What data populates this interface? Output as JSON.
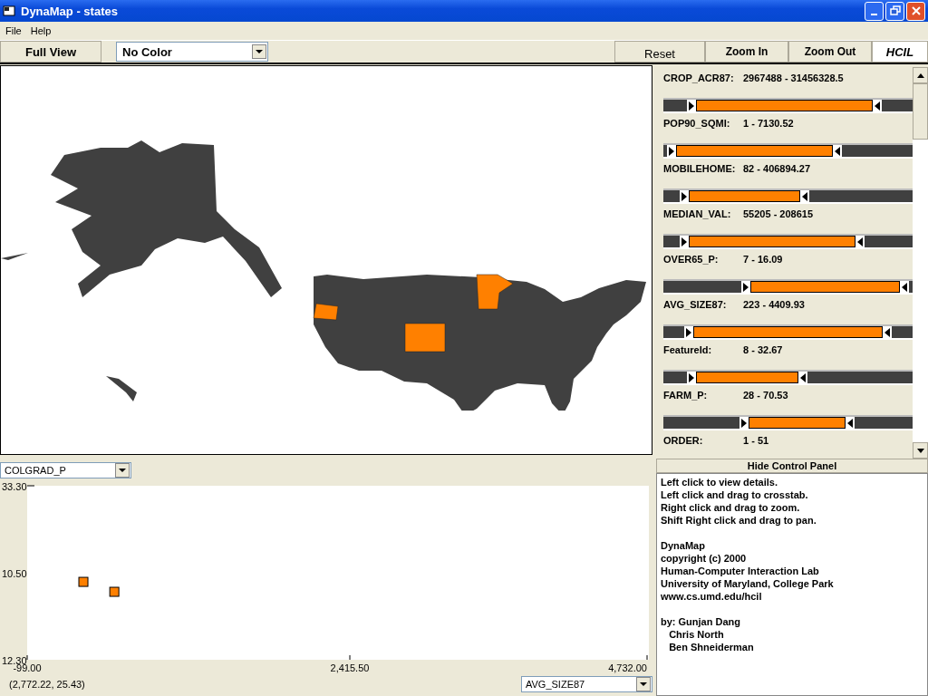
{
  "window": {
    "title": "DynaMap - states"
  },
  "menu": [
    "File",
    "Help"
  ],
  "toolbar": {
    "full_view": "Full View",
    "color_select": "No Color",
    "reset": "Reset",
    "zoom_in": "Zoom In",
    "zoom_out": "Zoom Out",
    "logo": "HCIL"
  },
  "sliders": [
    {
      "name": "CROP_ACR87:",
      "range": "2967488 - 31456328.5",
      "min_thumb": {
        "level": 0.13
      },
      "max_thumb": {
        "level": 0.84
      }
    },
    {
      "name": "POP90_SQMI:",
      "range": "1 - 7130.52",
      "min_thumb": {
        "level": 0.05
      },
      "max_thumb": {
        "level": 0.68
      }
    },
    {
      "name": "MOBILEHOME:",
      "range": "82 - 406894.27",
      "min_thumb": {
        "level": 0.1
      },
      "max_thumb": {
        "level": 0.55
      }
    },
    {
      "name": "MEDIAN_VAL:",
      "range": "55205 - 208615",
      "min_thumb": {
        "level": 0.1
      },
      "max_thumb": {
        "level": 0.77
      }
    },
    {
      "name": "OVER65_P:",
      "range": "7 - 16.09",
      "min_thumb": {
        "level": 0.35
      },
      "max_thumb": {
        "level": 0.95
      }
    },
    {
      "name": "AVG_SIZE87:",
      "range": "223 - 4409.93",
      "min_thumb": {
        "level": 0.12
      },
      "max_thumb": {
        "level": 0.88
      }
    },
    {
      "name": "FeatureId:",
      "range": "8 - 32.67",
      "min_thumb": {
        "level": 0.13
      },
      "max_thumb": {
        "level": 0.54
      }
    },
    {
      "name": "FARM_P:",
      "range": "28 - 70.53",
      "min_thumb": {
        "level": 0.34
      },
      "max_thumb": {
        "level": 0.73
      }
    }
  ],
  "last_slider": {
    "name": "ORDER:",
    "range": "1 - 51"
  },
  "hide_button": "Hide Control Panel",
  "info_paragraphs": [
    [
      "Left click to view details.",
      "Left click and drag to crosstab.",
      "Right click and drag to zoom.",
      "Shift Right click and drag to pan."
    ],
    [
      "DynaMap",
      "copyright (c) 2000",
      "Human-Computer Interaction Lab",
      "University of Maryland, College Park",
      "www.cs.umd.edu/hcil"
    ],
    [
      "by: Gunjan Dang",
      "   Chris North",
      "   Ben Shneiderman"
    ]
  ],
  "scatter": {
    "y_select": "COLGRAD_P",
    "x_select": "AVG_SIZE87",
    "cursor": "(2,772.22, 25.43)",
    "y_mid_label": "10.50",
    "chart_data": {
      "type": "scatter",
      "series": [
        {
          "color": "#ff8000",
          "x": [
            339,
            580
          ],
          "values": [
            21.7,
            20.5
          ]
        }
      ],
      "xlim": [
        -99,
        4732
      ],
      "ylim": [
        12.3,
        33.3
      ],
      "xticks": [
        {
          "value": -99,
          "label": "-99.00"
        },
        {
          "value": 2415.5,
          "label": "2,415.50"
        },
        {
          "value": 4732,
          "label": "4,732.00"
        }
      ],
      "yticks": [
        {
          "value": 33.3,
          "label": "33.30"
        },
        {
          "value": 12.3,
          "label": "12.30"
        }
      ]
    }
  }
}
